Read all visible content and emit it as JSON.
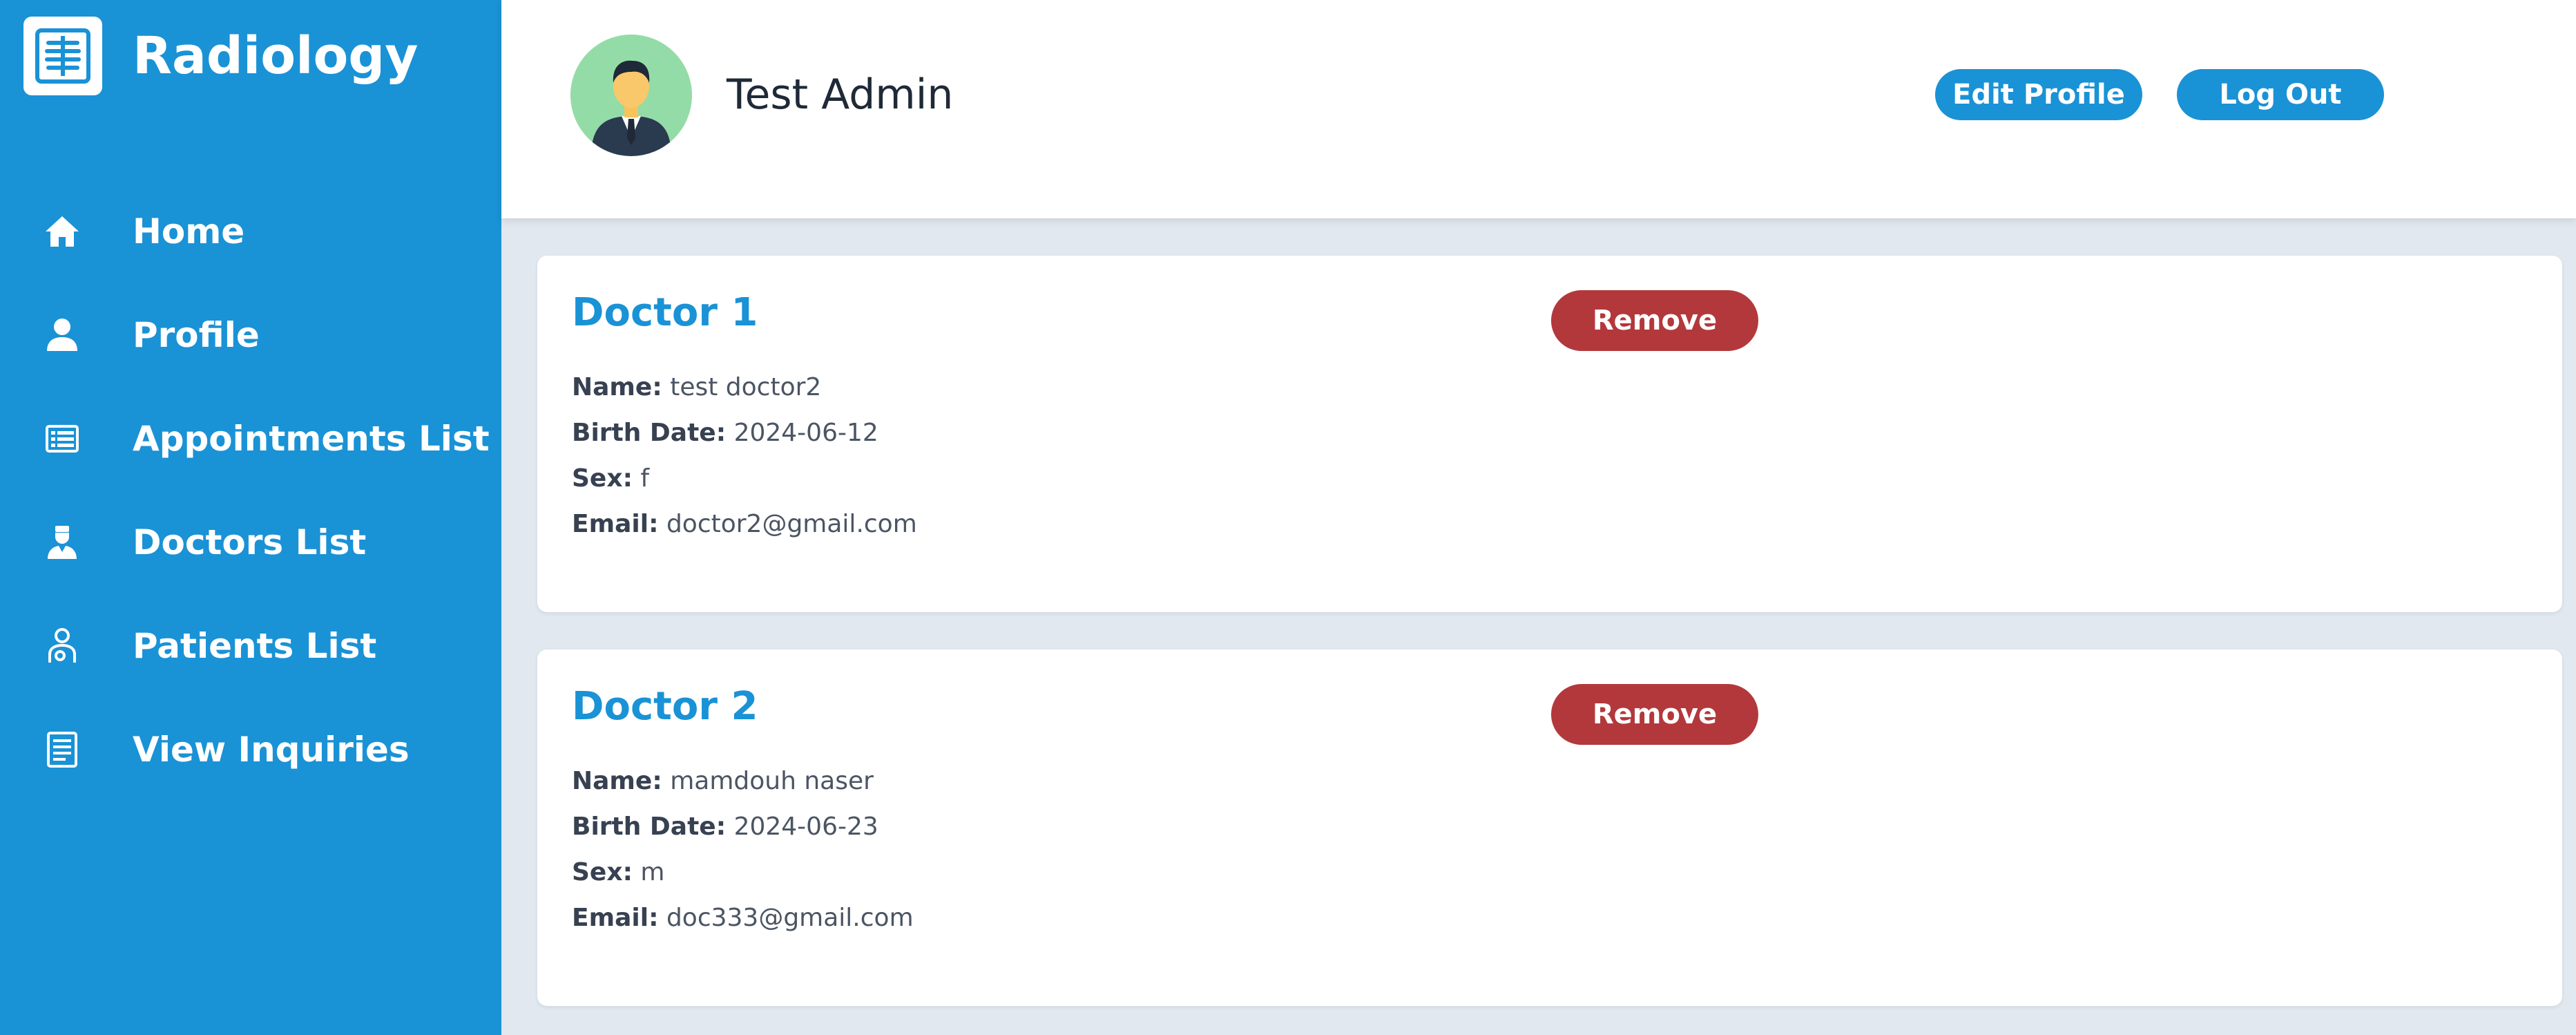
{
  "sidebar": {
    "brand": "Radiology",
    "brand_icon": "xray-logo-icon",
    "items": [
      {
        "label": "Home",
        "icon": "home-icon"
      },
      {
        "label": "Profile",
        "icon": "user-icon"
      },
      {
        "label": "Appointments List",
        "icon": "list-icon"
      },
      {
        "label": "Doctors List",
        "icon": "doctor-icon"
      },
      {
        "label": "Patients List",
        "icon": "patient-icon"
      },
      {
        "label": "View Inquiries",
        "icon": "inquiry-icon"
      }
    ]
  },
  "header": {
    "user_name": "Test Admin",
    "edit_profile_label": "Edit Profile",
    "logout_label": "Log Out"
  },
  "doctors": [
    {
      "title": "Doctor 1",
      "remove_label": "Remove",
      "name_label": "Name:",
      "name": "test doctor2",
      "birth_label": "Birth Date:",
      "birth_date": "2024-06-12",
      "sex_label": "Sex:",
      "sex": "f",
      "email_label": "Email:",
      "email": "doctor2@gmail.com"
    },
    {
      "title": "Doctor 2",
      "remove_label": "Remove",
      "name_label": "Name:",
      "name": "mamdouh naser",
      "birth_label": "Birth Date:",
      "birth_date": "2024-06-23",
      "sex_label": "Sex:",
      "sex": "m",
      "email_label": "Email:",
      "email": "doc333@gmail.com"
    }
  ],
  "colors": {
    "primary": "#1a92d6",
    "danger": "#b3383c",
    "background": "#e2e8f0"
  }
}
